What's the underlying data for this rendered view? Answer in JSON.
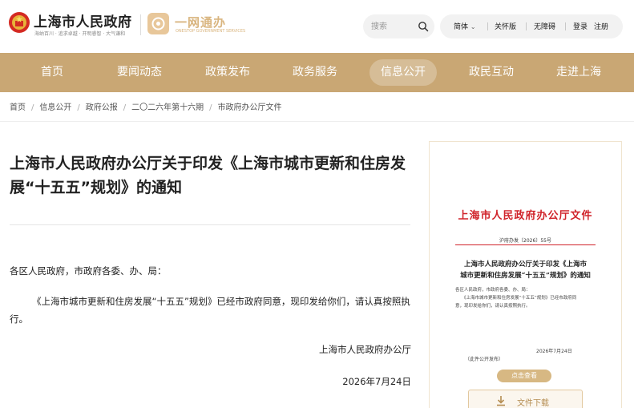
{
  "header": {
    "site_title": "上海市人民政府",
    "site_slogan": "海纳百川 · 追求卓越 · 开明睿智 · 大气谦和",
    "ywtb_title": "一网通办",
    "ywtb_sub": "ONESTOP GOVERNMENT SERVICES",
    "search_placeholder": "搜索",
    "util": {
      "lang": "简体",
      "care": "关怀版",
      "accessible": "无障碍",
      "login": "登录",
      "register": "注册"
    }
  },
  "nav": {
    "items": [
      {
        "label": "首页"
      },
      {
        "label": "要闻动态"
      },
      {
        "label": "政策发布"
      },
      {
        "label": "政务服务"
      },
      {
        "label": "信息公开"
      },
      {
        "label": "政民互动"
      },
      {
        "label": "走进上海"
      }
    ],
    "active_index": 4
  },
  "breadcrumb": [
    "首页",
    "信息公开",
    "政府公报",
    "二〇二六年第十六期",
    "市政府办公厅文件"
  ],
  "article": {
    "title": "上海市人民政府办公厅关于印发《上海市城市更新和住房发展“十五五”规划》的通知",
    "salutation": "各区人民政府，市政府各委、办、局：",
    "body": "《上海市城市更新和住房发展“十五五”规划》已经市政府同意，现印发给你们，请认真按照执行。",
    "issuer": "上海市人民政府办公厅",
    "date": "2026年7月24日"
  },
  "doc_preview": {
    "heading": "上海市人民政府办公厅文件",
    "number": "沪府办发〔2026〕55号",
    "subtitle_1": "上海市人民政府办公厅关于印发《上海市",
    "subtitle_2": "城市更新和住房发展“十五五”规划》的通知",
    "line_1": "各区人民政府，市政府各委、办、局：",
    "line_2": "《上海市城市更新和住房发展“十五五”规划》已经市政府同",
    "line_3": "意，现印发给你们，请认真按照执行。",
    "date": "2026年7月24日",
    "note": "（此件公开发布）",
    "view_label": "点击查看",
    "download_label": "文件下载"
  },
  "colors": {
    "nav_bg": "#c9a774",
    "doc_red": "#d0232a",
    "accent_gold": "#d7b883"
  }
}
